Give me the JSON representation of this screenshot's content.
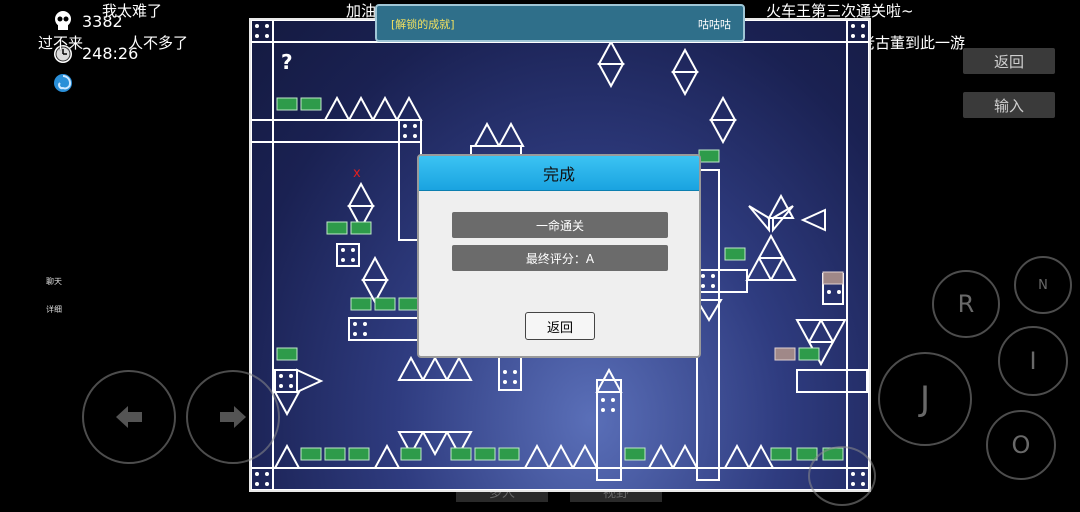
{
  "hud": {
    "deaths": "3382",
    "timer": "248:26",
    "skull_icon": "skull-icon",
    "clock_icon": "clock-icon",
    "swirl_icon": "swirl-icon"
  },
  "danmaku": [
    "我太难了",
    "过不来",
    "人不多了",
    "加油",
    "火车王第三次通关啦~",
    "老古董到此一游"
  ],
  "side_buttons": {
    "back": "返回",
    "input": "输入"
  },
  "side_labels": {
    "chat": "聊天",
    "detail": "详细"
  },
  "banner": {
    "left": "[解锁的成就]",
    "right": "咕咕咕"
  },
  "board": {
    "question": "?",
    "marker": "x"
  },
  "dialog": {
    "title": "完成",
    "row1": "一命通关",
    "row2": "最终评分：A",
    "back": "返回"
  },
  "controls": {
    "r": "R",
    "n": "N",
    "j": "J",
    "i": "I",
    "o": "O"
  },
  "under_buttons": {
    "multi": "多人",
    "view": "视野"
  },
  "colors": {
    "accent": "#1aa3e0",
    "board_bg": "#2f3c80",
    "sign_green": "#2e9b4a"
  }
}
